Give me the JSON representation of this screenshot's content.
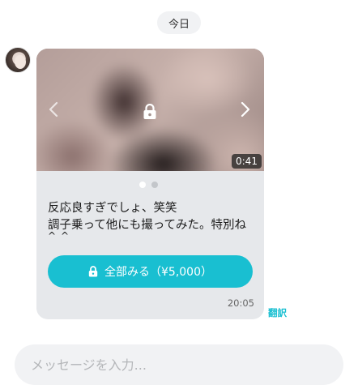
{
  "header": {
    "date_label": "今日"
  },
  "message": {
    "sender_avatar_icon": "avatar",
    "media": {
      "duration": "0:41",
      "locked": true,
      "prev_icon": "chevron-left-icon",
      "next_icon": "chevron-right-icon",
      "lock_icon": "lock-icon",
      "pages_total": 2,
      "page_active": 1
    },
    "text": "反応良すぎでしょ、笑笑\n調子乗って他にも撮ってみた。特別ね",
    "text_overflow": "^_^",
    "unlock_button_label": "全部みる（¥5,000）",
    "time": "20:05",
    "translate_label": "翻訳"
  },
  "composer": {
    "placeholder": "メッセージを入力..."
  },
  "colors": {
    "accent": "#19bfd1",
    "bubble_bg": "#e6e8eb",
    "pill_bg": "#f1f2f4"
  }
}
